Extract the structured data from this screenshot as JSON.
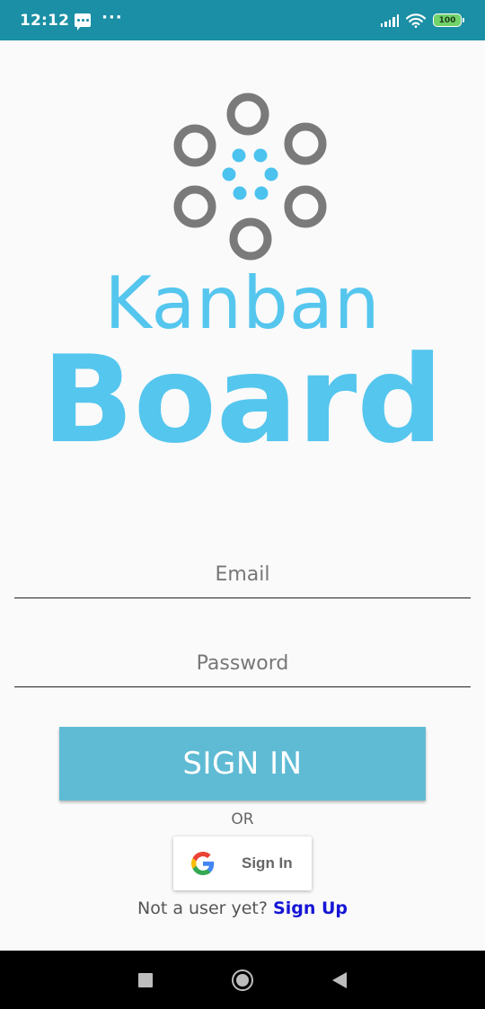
{
  "status_bar": {
    "time": "12:12",
    "more": "···",
    "battery": "100",
    "icons": [
      "message-icon",
      "signal-icon",
      "wifi-icon",
      "battery-icon"
    ]
  },
  "logo": {
    "line1": "Kanban",
    "line2": "Board",
    "colors": {
      "text": "#55c6ee",
      "rings": "#7a7a7a",
      "dots": "#4cc3ef"
    }
  },
  "form": {
    "email_placeholder": "Email",
    "password_placeholder": "Password",
    "signin_label": "SIGN IN",
    "or_label": "OR",
    "google_label": "Sign In",
    "signup_prompt": "Not a user yet?",
    "signup_link": "Sign Up"
  },
  "nav_bar": {
    "icons": [
      "recents-icon",
      "home-icon",
      "back-icon"
    ]
  },
  "colors": {
    "status_bar": "#1b8fa5",
    "button": "#5fbbd4",
    "link": "#1515d6",
    "background": "#fafafa"
  }
}
